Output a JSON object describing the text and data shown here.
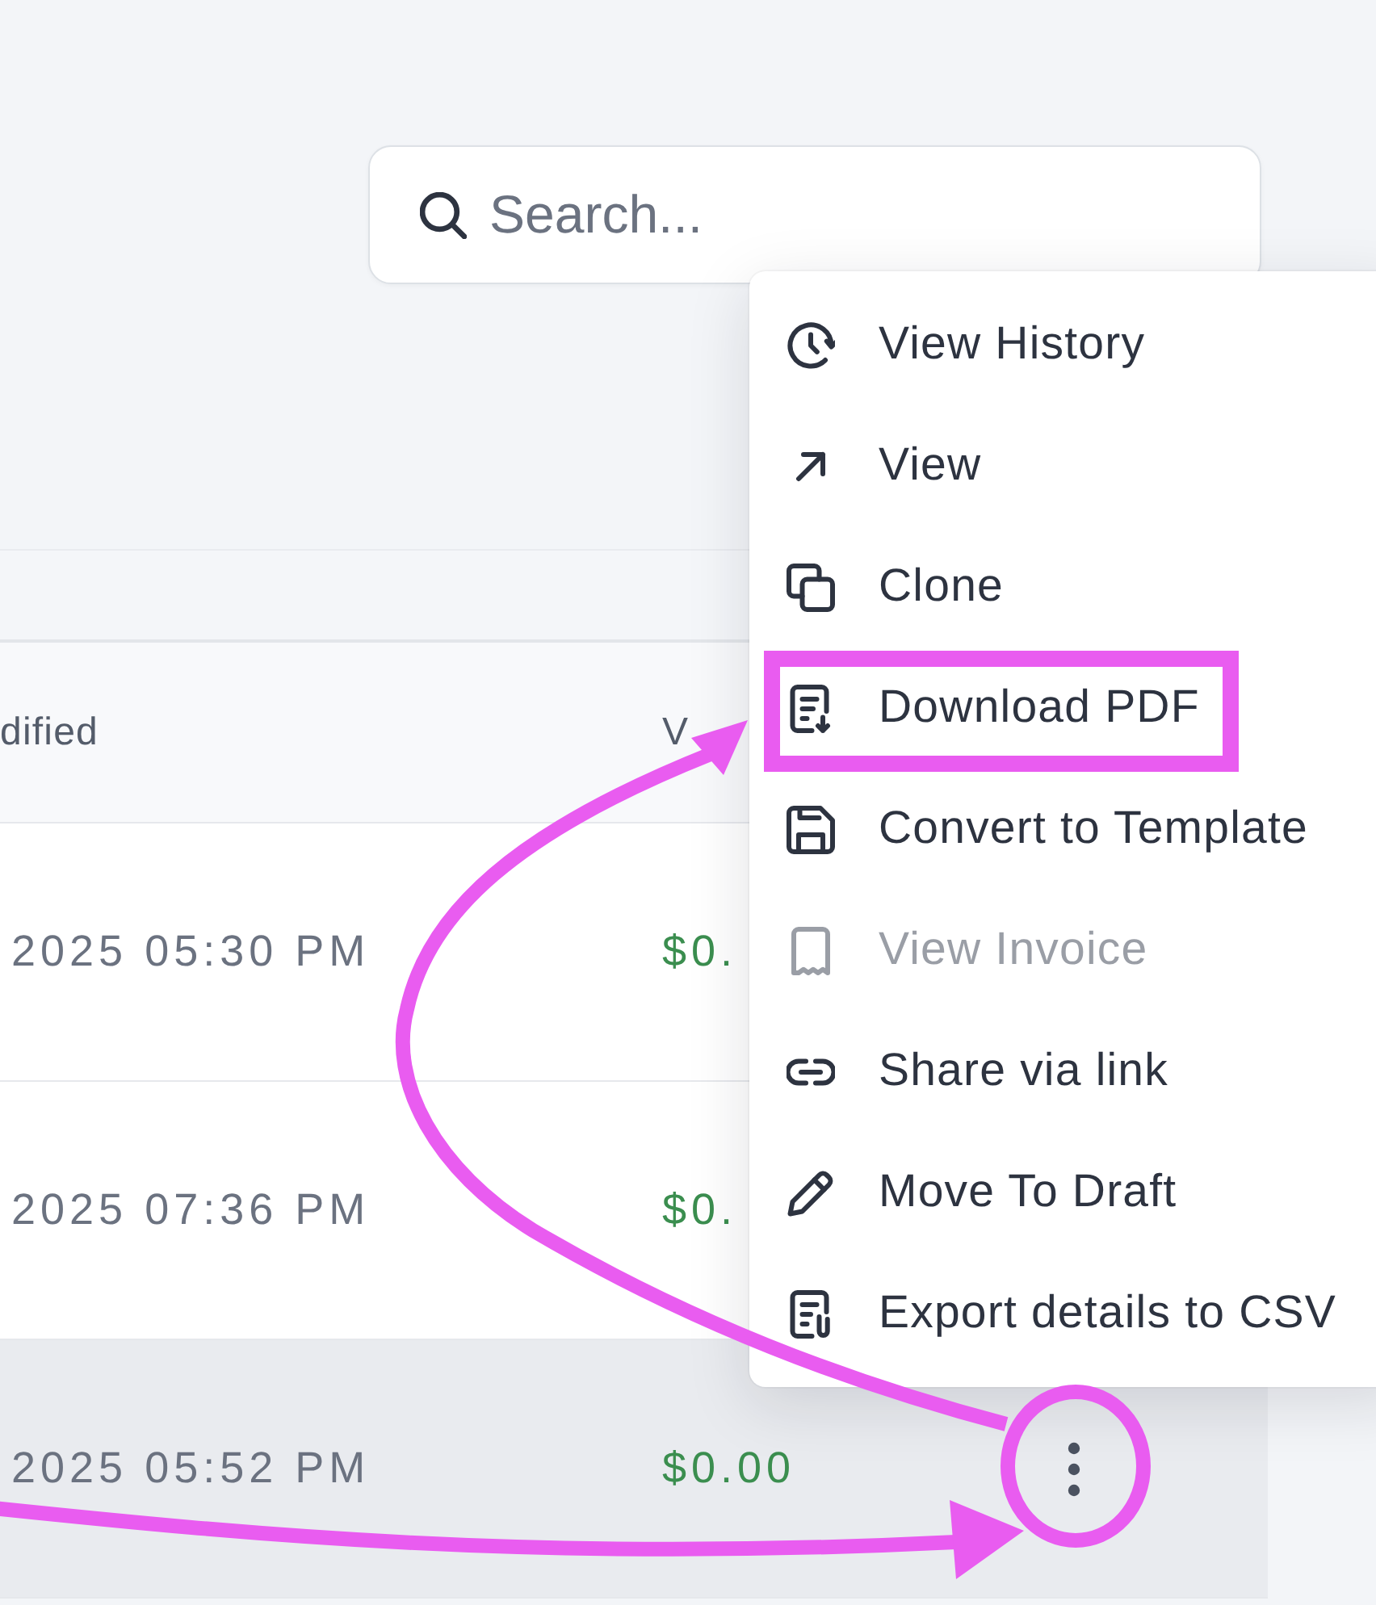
{
  "search": {
    "placeholder": "Search..."
  },
  "table": {
    "columns": [
      {
        "label": "dified"
      },
      {
        "label": "V"
      }
    ],
    "rows": [
      {
        "cells": [
          "2025 05:30 PM",
          "$0."
        ],
        "hovered": false
      },
      {
        "cells": [
          "2025 07:36 PM",
          "$0."
        ],
        "hovered": false
      },
      {
        "cells": [
          "2025 05:52 PM",
          "$0.00"
        ],
        "hovered": true,
        "actions": {
          "annotated": true
        }
      }
    ]
  },
  "menu": {
    "items": [
      {
        "label": "View History",
        "disabled": false,
        "annotated": false
      },
      {
        "label": "View",
        "disabled": false,
        "annotated": false
      },
      {
        "label": "Clone",
        "disabled": false,
        "annotated": false
      },
      {
        "label": "Download PDF",
        "disabled": false,
        "annotated": true
      },
      {
        "label": "Convert to Template",
        "disabled": false,
        "annotated": false
      },
      {
        "label": "View Invoice",
        "disabled": true,
        "annotated": false
      },
      {
        "label": "Share via link",
        "disabled": false,
        "annotated": false
      },
      {
        "label": "Move To Draft",
        "disabled": false,
        "annotated": false
      },
      {
        "label": "Export details to CSV",
        "disabled": false,
        "annotated": false
      }
    ]
  }
}
